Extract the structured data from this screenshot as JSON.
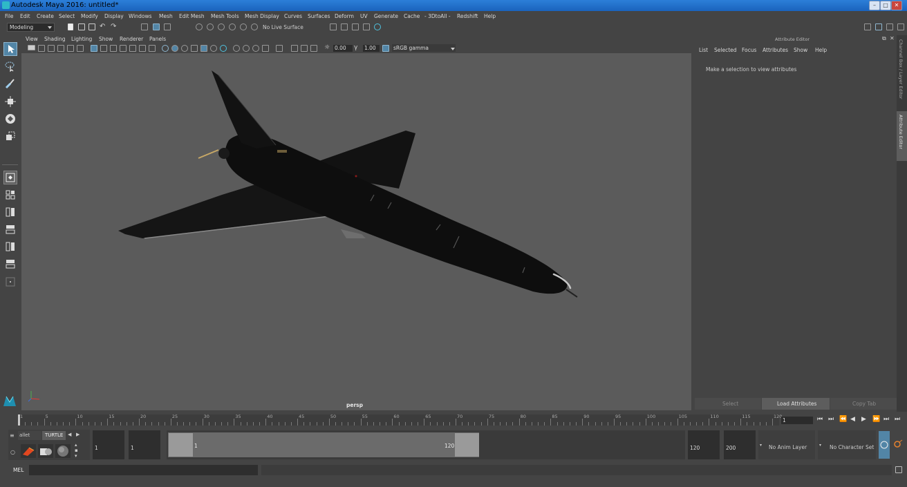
{
  "window": {
    "title": "Autodesk Maya 2016: untitled*",
    "controls": [
      "–",
      "□",
      "✕"
    ]
  },
  "menubar": [
    "File",
    "Edit",
    "Create",
    "Select",
    "Modify",
    "Display",
    "Windows",
    "Mesh",
    "Edit Mesh",
    "Mesh Tools",
    "Mesh Display",
    "Curves",
    "Surfaces",
    "Deform",
    "UV",
    "Generate",
    "Cache",
    "- 3DtoAll -",
    "Redshift",
    "Help"
  ],
  "statusline": {
    "menuset": "Modeling",
    "live_surface": "No Live Surface"
  },
  "panel": {
    "menus": [
      "View",
      "Shading",
      "Lighting",
      "Show",
      "Renderer",
      "Panels"
    ],
    "exposure": "0.00",
    "gamma": "1.00",
    "color_space": "sRGB gamma",
    "camera_label": "persp"
  },
  "attribute_editor": {
    "title": "Attribute Editor",
    "menus": [
      "List",
      "Selected",
      "Focus",
      "Attributes",
      "Show",
      "Help"
    ],
    "message": "Make a selection to view attributes",
    "buttons": [
      "Select",
      "Load Attributes",
      "Copy Tab"
    ]
  },
  "side_tabs": [
    "Channel Box / Layer Editor",
    "Attribute Editor"
  ],
  "timeline": {
    "ticks": [
      "1",
      "5",
      "10",
      "15",
      "20",
      "25",
      "30",
      "35",
      "40",
      "45",
      "50",
      "55",
      "60",
      "65",
      "70",
      "75",
      "80",
      "85",
      "90",
      "95",
      "100",
      "105",
      "110",
      "115",
      "120"
    ],
    "current_frame": "1"
  },
  "shelf": {
    "tabs": [
      "allet",
      "TURTLE"
    ]
  },
  "range": {
    "start": "1",
    "playback_start": "1",
    "slider_start": "1",
    "slider_end": "120",
    "playback_end": "120",
    "end": "200",
    "anim_layer": "No Anim Layer",
    "character_set": "No Character Set"
  },
  "command": {
    "lang": "MEL"
  },
  "colors": {
    "titlebar": "#1f6fd0",
    "viewport_bg": "#5b5b5b",
    "active_tool": "#5285a6",
    "active_button": "#5d5d5d"
  }
}
